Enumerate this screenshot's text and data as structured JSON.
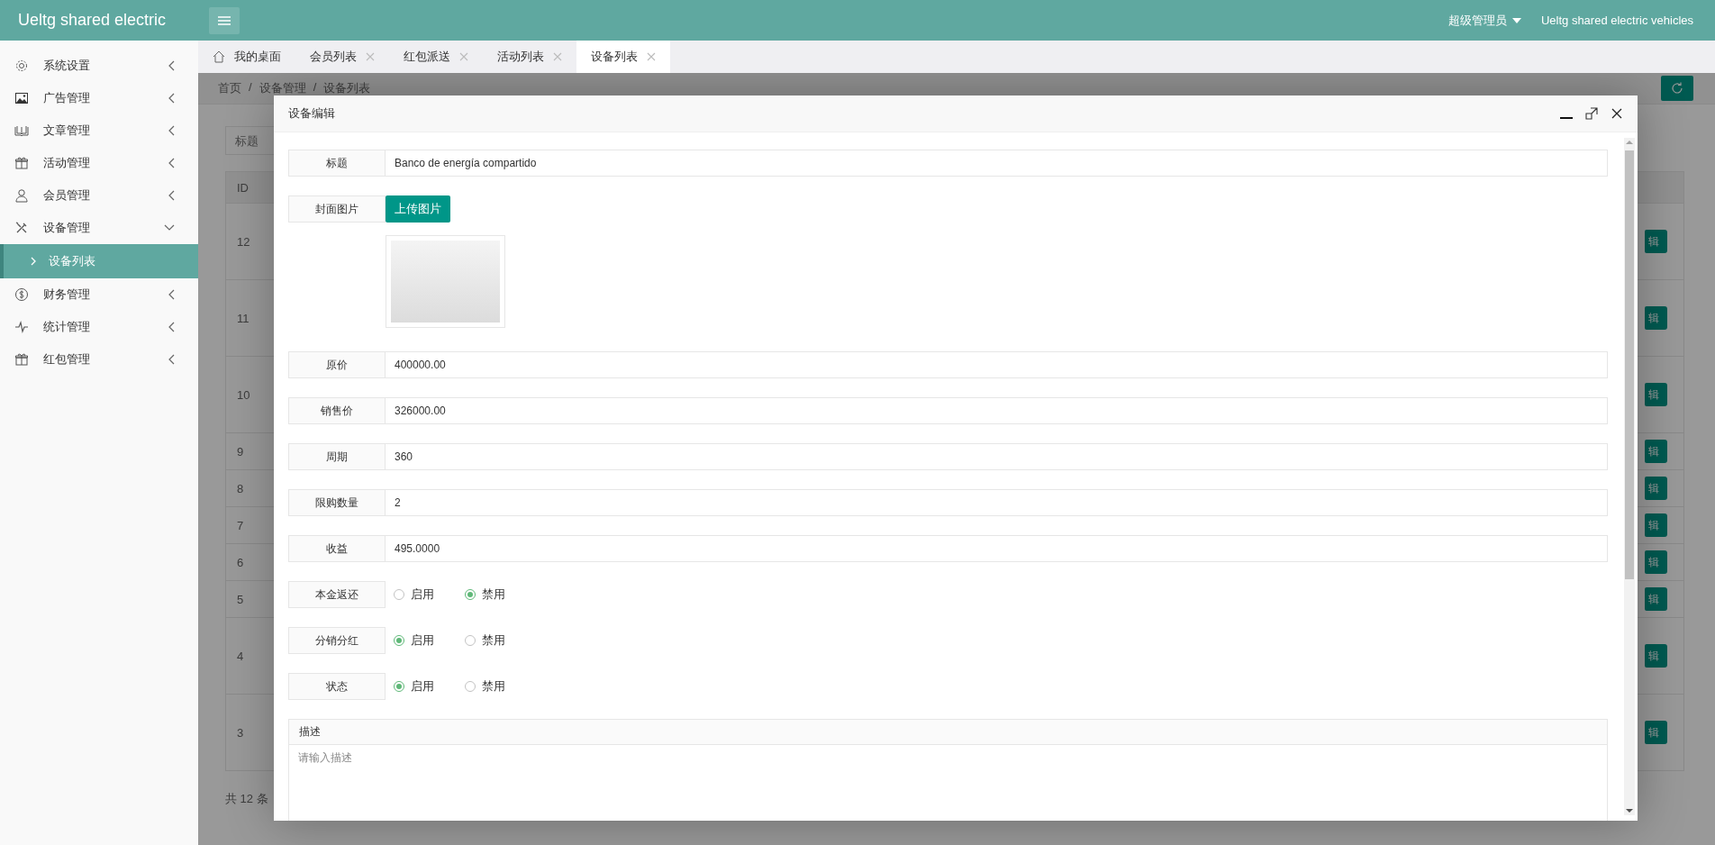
{
  "header": {
    "brand": "Ueltg shared electric",
    "user": "超级管理员",
    "site": "Ueltg shared electric vehicles"
  },
  "sidebar": {
    "items": [
      {
        "label": "系统设置",
        "expanded": false
      },
      {
        "label": "广告管理",
        "expanded": false
      },
      {
        "label": "文章管理",
        "expanded": false
      },
      {
        "label": "活动管理",
        "expanded": false
      },
      {
        "label": "会员管理",
        "expanded": false
      },
      {
        "label": "设备管理",
        "expanded": true,
        "children": [
          {
            "label": "设备列表",
            "selected": true
          }
        ]
      },
      {
        "label": "财务管理",
        "expanded": false
      },
      {
        "label": "统计管理",
        "expanded": false
      },
      {
        "label": "红包管理",
        "expanded": false
      }
    ]
  },
  "tabs": [
    {
      "label": "我的桌面",
      "kind": "home",
      "selected": false
    },
    {
      "label": "会员列表",
      "kind": "closable",
      "selected": false
    },
    {
      "label": "红包派送",
      "kind": "closable",
      "selected": false
    },
    {
      "label": "活动列表",
      "kind": "closable",
      "selected": false
    },
    {
      "label": "设备列表",
      "kind": "closable",
      "selected": true
    }
  ],
  "breadcrumb": {
    "items": [
      "首页",
      "设备管理",
      "设备列表"
    ],
    "separator": "/"
  },
  "search": {
    "placeholder": "标题"
  },
  "table": {
    "columns": [
      "ID"
    ],
    "rows": [
      {
        "id": "12",
        "action": "辑"
      },
      {
        "id": "11",
        "action": "辑"
      },
      {
        "id": "10",
        "action": "辑"
      },
      {
        "id": "9",
        "action": "辑"
      },
      {
        "id": "8",
        "action": "辑"
      },
      {
        "id": "7",
        "action": "辑"
      },
      {
        "id": "6",
        "action": "辑"
      },
      {
        "id": "5",
        "action": "辑"
      },
      {
        "id": "4",
        "action": "辑"
      },
      {
        "id": "3",
        "action": "辑"
      }
    ],
    "total": "共 12 条"
  },
  "modal": {
    "title": "设备编辑",
    "fields": [
      {
        "kind": "text",
        "label": "标题",
        "value": "Banco de energía compartido"
      },
      {
        "kind": "image",
        "label": "封面图片",
        "button": "上传图片"
      },
      {
        "kind": "text",
        "label": "原价",
        "value": "400000.00"
      },
      {
        "kind": "text",
        "label": "销售价",
        "value": "326000.00"
      },
      {
        "kind": "text",
        "label": "周期",
        "value": "360"
      },
      {
        "kind": "text",
        "label": "限购数量",
        "value": "2"
      },
      {
        "kind": "text",
        "label": "收益",
        "value": "495.0000"
      },
      {
        "kind": "radio",
        "label": "本金返还",
        "options": [
          {
            "label": "启用",
            "selected": false
          },
          {
            "label": "禁用",
            "selected": true
          }
        ]
      },
      {
        "kind": "radio",
        "label": "分销分红",
        "options": [
          {
            "label": "启用",
            "selected": true
          },
          {
            "label": "禁用",
            "selected": false
          }
        ]
      },
      {
        "kind": "radio",
        "label": "状态",
        "options": [
          {
            "label": "启用",
            "selected": true
          },
          {
            "label": "禁用",
            "selected": false
          }
        ]
      },
      {
        "kind": "textarea",
        "label": "描述",
        "placeholder": "请输入描述"
      }
    ]
  }
}
